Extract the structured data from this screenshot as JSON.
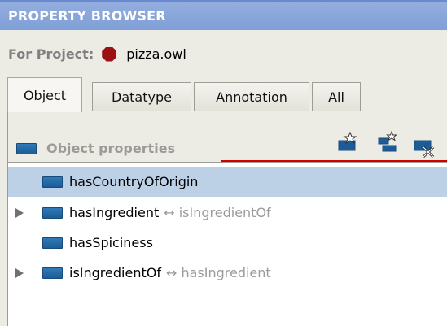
{
  "window": {
    "title": "PROPERTY BROWSER"
  },
  "project": {
    "label": "For Project:",
    "file": "pizza.owl"
  },
  "tabs": [
    {
      "label": "Object",
      "active": true
    },
    {
      "label": "Datatype",
      "active": false
    },
    {
      "label": "Annotation",
      "active": false
    },
    {
      "label": "All",
      "active": false
    }
  ],
  "section": {
    "title": "Object properties"
  },
  "toolbar": {
    "create_property_icon": "create-property-icon",
    "create_subproperty_icon": "create-subproperty-icon",
    "delete_property_icon": "delete-property-icon"
  },
  "properties": [
    {
      "name": "hasCountryOfOrigin",
      "inverse": "",
      "expandable": false,
      "selected": true
    },
    {
      "name": "hasIngredient",
      "inverse": "↔ isIngredientOf",
      "expandable": true,
      "selected": false
    },
    {
      "name": "hasSpiciness",
      "inverse": "",
      "expandable": false,
      "selected": false
    },
    {
      "name": "isIngredientOf",
      "inverse": "↔ hasIngredient",
      "expandable": true,
      "selected": false
    }
  ],
  "colors": {
    "title_bar": "#7f9fd7",
    "selection": "#bcd1e6",
    "property_icon": "#1d5c96",
    "project_icon": "#9c0f12",
    "annotation_line": "#d40000"
  }
}
